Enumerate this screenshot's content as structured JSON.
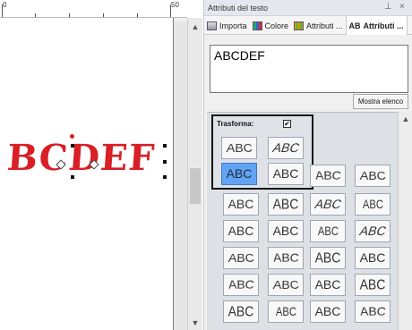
{
  "ruler": {
    "label_left": "0",
    "label_right": "50"
  },
  "canvas": {
    "design_text": "BCDEF"
  },
  "panel": {
    "title": "Attributi del testo",
    "pin_icon": "pin-icon",
    "close_label": "×",
    "tabs": [
      {
        "label": "Importa",
        "icon": "import-icon"
      },
      {
        "label": "Colore",
        "icon": "color-icon"
      },
      {
        "label": "Attributi ...",
        "icon": "attributes-icon"
      },
      {
        "label": "Attributi ...",
        "icon": "ab-icon",
        "icon_text": "AB"
      }
    ],
    "text_value": "ABCDEF",
    "show_list_button": "Mostra elenco"
  },
  "transform": {
    "label": "Trasforma:",
    "checked": true,
    "check_mark": "✔"
  },
  "shapes": {
    "label": "ABC",
    "selected_index": 2,
    "selected_color": "#62a3f4"
  }
}
